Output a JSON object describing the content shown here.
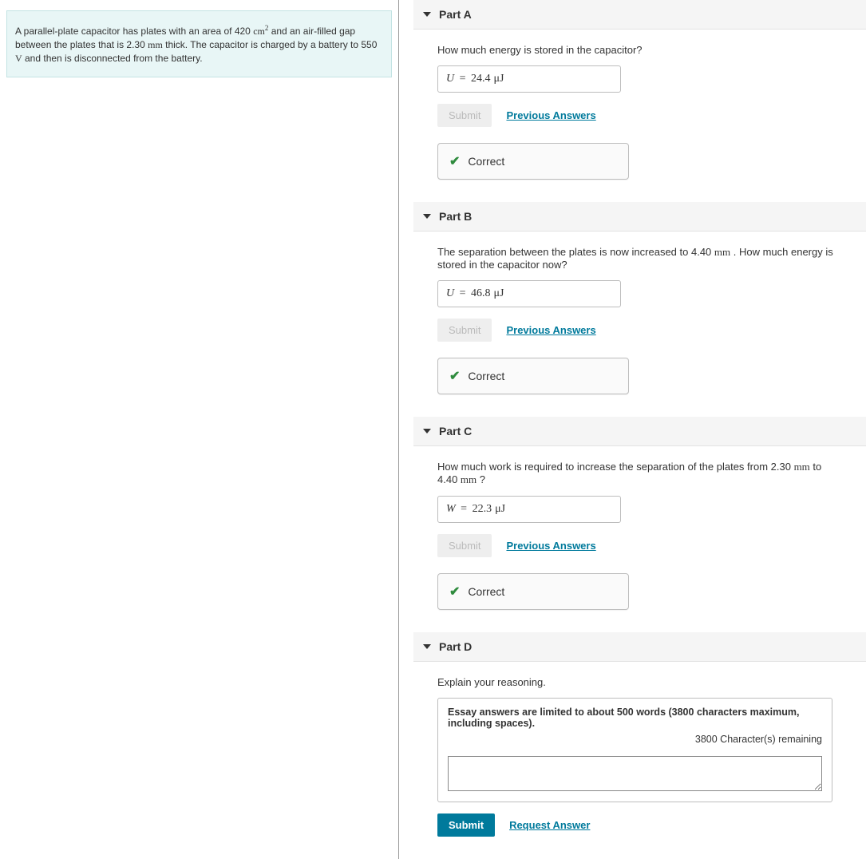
{
  "info": {
    "text_pre": "A parallel-plate capacitor has plates with an area of 420 ",
    "unit1": "cm",
    "sup1": "2",
    "text_mid1": " and an air-filled gap between the plates that is 2.30 ",
    "unit2": "mm",
    "text_mid2": " thick. The capacitor is charged by a battery to 550 ",
    "unit3": "V",
    "text_end": " and then is disconnected from the battery."
  },
  "parts": {
    "a": {
      "title": "Part A",
      "prompt": "How much energy is stored in the capacitor?",
      "var": "U",
      "eq": " = ",
      "value": "24.4",
      "unit": "μJ",
      "submit": "Submit",
      "prev": "Previous Answers",
      "feedback": "Correct"
    },
    "b": {
      "title": "Part B",
      "prompt_pre": "The separation between the plates is now increased to 4.40 ",
      "prompt_unit": "mm",
      "prompt_post": " . How much energy is stored in the capacitor now?",
      "var": "U",
      "eq": " = ",
      "value": "46.8",
      "unit": "μJ",
      "submit": "Submit",
      "prev": "Previous Answers",
      "feedback": "Correct"
    },
    "c": {
      "title": "Part C",
      "prompt_pre": "How much work is required to increase the separation of the plates from 2.30 ",
      "prompt_unit1": "mm",
      "prompt_mid": " to 4.40 ",
      "prompt_unit2": "mm",
      "prompt_post": " ?",
      "var": "W",
      "eq": " = ",
      "value": "22.3",
      "unit": "μJ",
      "submit": "Submit",
      "prev": "Previous Answers",
      "feedback": "Correct"
    },
    "d": {
      "title": "Part D",
      "prompt": "Explain your reasoning.",
      "note": "Essay answers are limited to about 500 words (3800 characters maximum, including spaces).",
      "remain": "3800 Character(s) remaining",
      "submit": "Submit",
      "request": "Request Answer"
    }
  }
}
